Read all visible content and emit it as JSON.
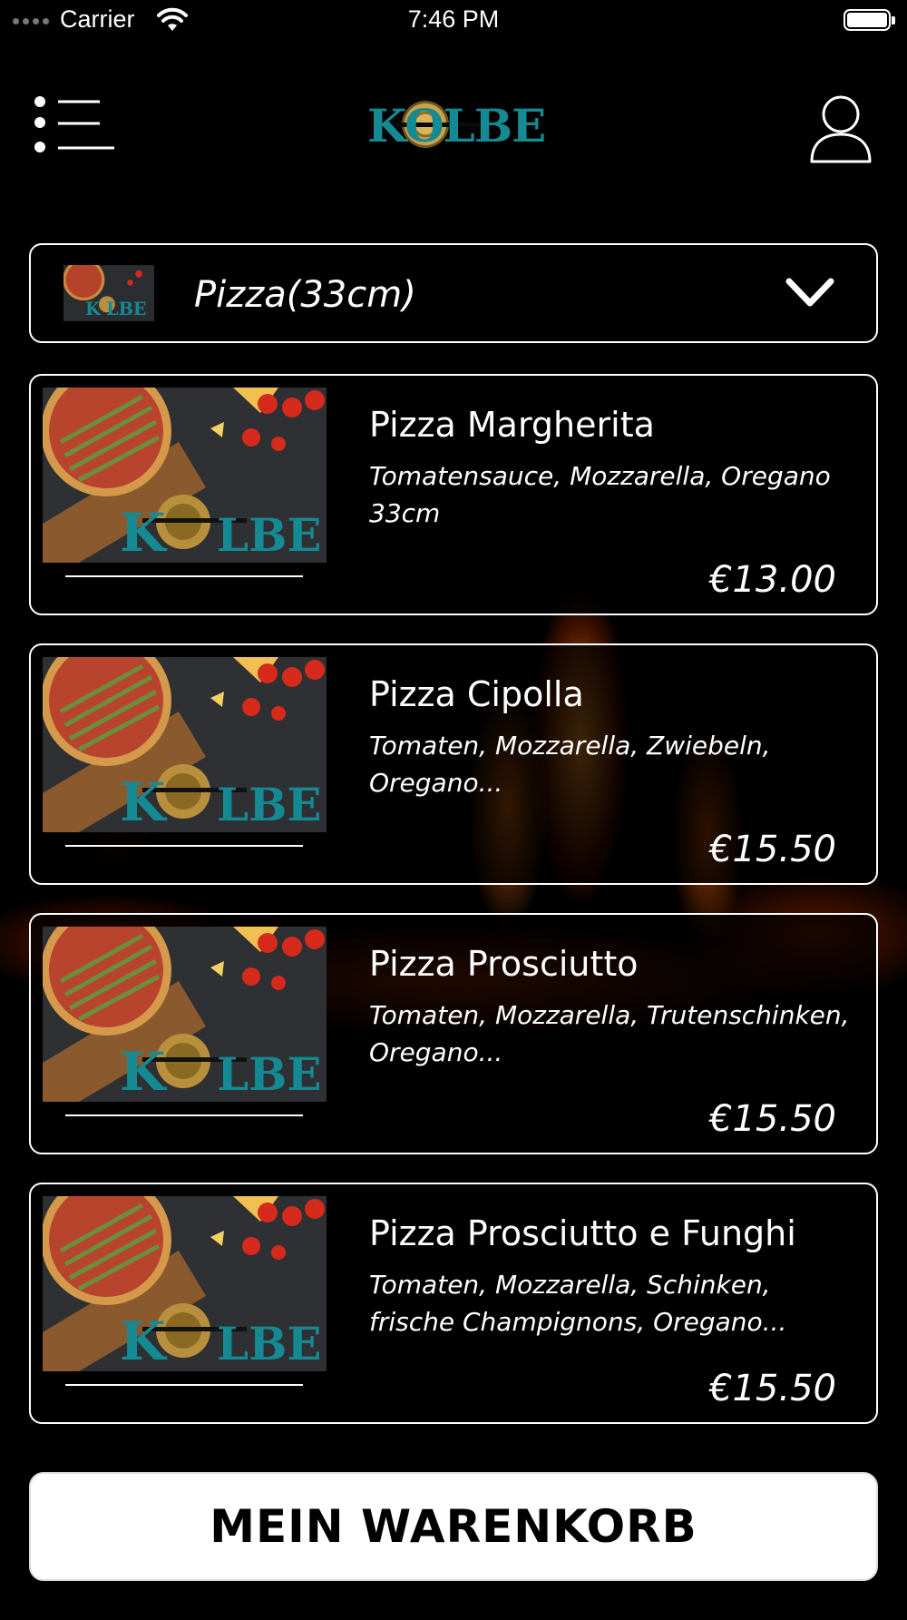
{
  "status_bar": {
    "carrier": "Carrier",
    "time": "7:46 PM"
  },
  "header": {
    "logo_text": "KOLBE",
    "menu_icon": "list-menu-icon",
    "user_icon": "user-profile-icon"
  },
  "category": {
    "selected": "Pizza(33cm)",
    "icon": "chevron-down-icon"
  },
  "products": [
    {
      "name": "Pizza Margherita",
      "description": "Tomatensauce, Mozzarella, Oregano 33cm",
      "price": "€13.00"
    },
    {
      "name": "Pizza Cipolla",
      "description": "Tomaten, Mozzarella, Zwiebeln, Oregano...",
      "price": "€15.50"
    },
    {
      "name": "Pizza Prosciutto",
      "description": "Tomaten, Mozzarella, Trutenschinken, Oregano...",
      "price": "€15.50"
    },
    {
      "name": "Pizza Prosciutto e Funghi",
      "description": "Tomaten, Mozzarella, Schinken, frische Champignons, Oregano...",
      "price": "€15.50"
    }
  ],
  "cart_button": {
    "label": "MEIN WARENKORB"
  },
  "colors": {
    "background": "#000000",
    "logo_teal": "#168a92",
    "logo_gold": "#c9a24c",
    "button_bg": "#ffffff"
  }
}
